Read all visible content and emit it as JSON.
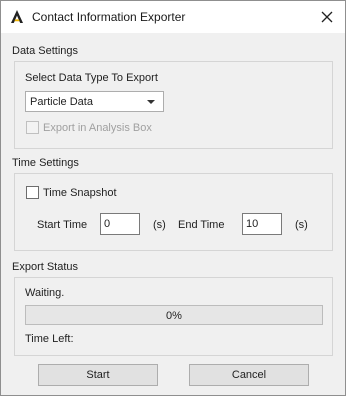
{
  "window": {
    "title": "Contact Information Exporter",
    "icon": "app-logo-icon",
    "close_icon": "close-icon"
  },
  "data_settings": {
    "section_label": "Data Settings",
    "select_type_label": "Select Data Type To Export",
    "data_type_value": "Particle Data",
    "export_in_box_label": "Export in Analysis Box",
    "export_in_box_checked": false,
    "export_in_box_enabled": false
  },
  "time_settings": {
    "section_label": "Time Settings",
    "snapshot_label": "Time Snapshot",
    "snapshot_checked": false,
    "start_label": "Start Time",
    "start_value": "0",
    "start_unit": "(s)",
    "end_label": "End Time",
    "end_value": "10",
    "end_unit": "(s)"
  },
  "export_status": {
    "section_label": "Export Status",
    "status_text": "Waiting.",
    "progress_percent": 0,
    "progress_text": "0%",
    "time_left_label": "Time Left:"
  },
  "buttons": {
    "start": "Start",
    "cancel": "Cancel"
  }
}
